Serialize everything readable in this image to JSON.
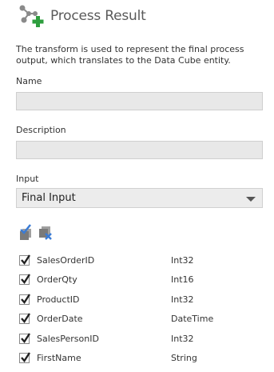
{
  "header": {
    "title": "Process Result",
    "icon": "process-result-icon"
  },
  "description": "The transform is used to represent the final process output, which translates to the Data Cube entity.",
  "fields": {
    "name": {
      "label": "Name",
      "value": ""
    },
    "description": {
      "label": "Description",
      "value": ""
    },
    "input": {
      "label": "Input",
      "selected": "Final Input"
    }
  },
  "toolbar": {
    "select_all_icon": "select-all-icon",
    "deselect_all_icon": "deselect-all-icon"
  },
  "columns": [
    {
      "name": "SalesOrderID",
      "type": "Int32",
      "checked": true
    },
    {
      "name": "OrderQty",
      "type": "Int16",
      "checked": true
    },
    {
      "name": "ProductID",
      "type": "Int32",
      "checked": true
    },
    {
      "name": "OrderDate",
      "type": "DateTime",
      "checked": true
    },
    {
      "name": "SalesPersonID",
      "type": "Int32",
      "checked": true
    },
    {
      "name": "FirstName",
      "type": "String",
      "checked": true
    }
  ],
  "colors": {
    "accent_green": "#2e9e3e",
    "icon_gray": "#8a8a8a",
    "icon_blue": "#3a7bd5",
    "icon_red": "#d03030"
  }
}
